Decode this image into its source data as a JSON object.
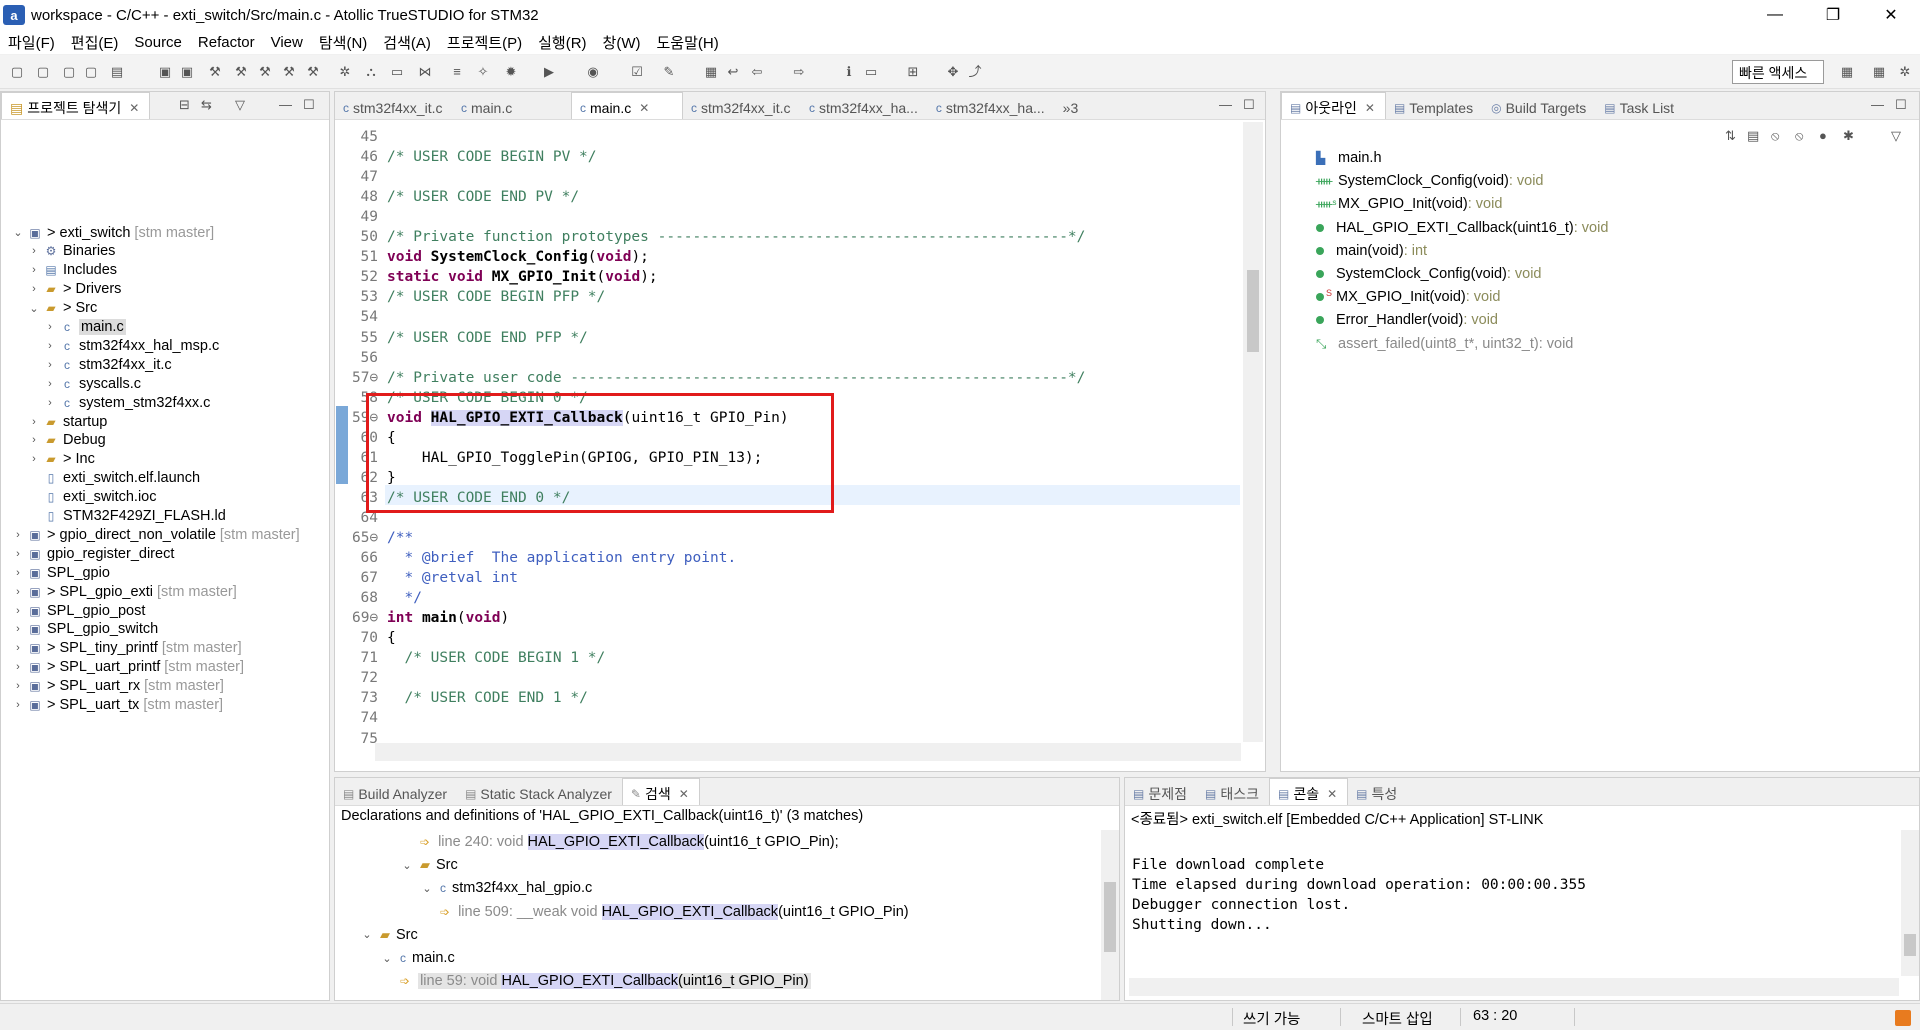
{
  "window": {
    "title": "workspace - C/C++ - exti_switch/Src/main.c - Atollic TrueSTUDIO for STM32",
    "app_icon": "a",
    "minimize": "—",
    "maximize": "❐",
    "close": "✕"
  },
  "menu": [
    "파일(F)",
    "편집(E)",
    "Source",
    "Refactor",
    "View",
    "탐색(N)",
    "검색(A)",
    "프로젝트(P)",
    "실행(R)",
    "창(W)",
    "도움말(H)"
  ],
  "toolbar": {
    "quick_access": "빠른 액세스"
  },
  "explorer": {
    "tab_label": "프로젝트 탐색기",
    "items": [
      {
        "indent": 0,
        "twisty": "⌄",
        "icon": "proj",
        "prefix": "> ",
        "label": "exti_switch",
        "git": "[stm master]"
      },
      {
        "indent": 1,
        "twisty": "›",
        "icon": "bin",
        "prefix": "",
        "label": "Binaries",
        "git": ""
      },
      {
        "indent": 1,
        "twisty": "›",
        "icon": "inc",
        "prefix": "",
        "label": "Includes",
        "git": ""
      },
      {
        "indent": 1,
        "twisty": "›",
        "icon": "folder-src",
        "prefix": "> ",
        "label": "Drivers",
        "git": ""
      },
      {
        "indent": 1,
        "twisty": "⌄",
        "icon": "folder-src",
        "prefix": "> ",
        "label": "Src",
        "git": ""
      },
      {
        "indent": 2,
        "twisty": "›",
        "icon": "cfile",
        "prefix": "",
        "label": "main.c",
        "git": ""
      },
      {
        "indent": 2,
        "twisty": "›",
        "icon": "cfile",
        "prefix": "",
        "label": "stm32f4xx_hal_msp.c",
        "git": ""
      },
      {
        "indent": 2,
        "twisty": "›",
        "icon": "cfile",
        "prefix": "",
        "label": "stm32f4xx_it.c",
        "git": ""
      },
      {
        "indent": 2,
        "twisty": "›",
        "icon": "cfile",
        "prefix": "",
        "label": "syscalls.c",
        "git": ""
      },
      {
        "indent": 2,
        "twisty": "›",
        "icon": "cfile",
        "prefix": "",
        "label": "system_stm32f4xx.c",
        "git": ""
      },
      {
        "indent": 1,
        "twisty": "›",
        "icon": "folder-src",
        "prefix": "",
        "label": "startup",
        "git": ""
      },
      {
        "indent": 1,
        "twisty": "›",
        "icon": "folder",
        "prefix": "",
        "label": "Debug",
        "git": ""
      },
      {
        "indent": 1,
        "twisty": "›",
        "icon": "folder-src",
        "prefix": "> ",
        "label": "Inc",
        "git": ""
      },
      {
        "indent": 1,
        "twisty": "",
        "icon": "file",
        "prefix": "",
        "label": "exti_switch.elf.launch",
        "git": ""
      },
      {
        "indent": 1,
        "twisty": "",
        "icon": "file",
        "prefix": "",
        "label": "exti_switch.ioc",
        "git": ""
      },
      {
        "indent": 1,
        "twisty": "",
        "icon": "file",
        "prefix": "",
        "label": "STM32F429ZI_FLASH.ld",
        "git": ""
      },
      {
        "indent": 0,
        "twisty": "›",
        "icon": "proj",
        "prefix": "> ",
        "label": "gpio_direct_non_volatile",
        "git": "[stm master]"
      },
      {
        "indent": 0,
        "twisty": "›",
        "icon": "proj",
        "prefix": "",
        "label": "gpio_register_direct",
        "git": ""
      },
      {
        "indent": 0,
        "twisty": "›",
        "icon": "proj",
        "prefix": "",
        "label": "SPL_gpio",
        "git": ""
      },
      {
        "indent": 0,
        "twisty": "›",
        "icon": "proj",
        "prefix": "> ",
        "label": "SPL_gpio_exti",
        "git": "[stm master]"
      },
      {
        "indent": 0,
        "twisty": "›",
        "icon": "proj",
        "prefix": "",
        "label": "SPL_gpio_post",
        "git": ""
      },
      {
        "indent": 0,
        "twisty": "›",
        "icon": "proj",
        "prefix": "",
        "label": "SPL_gpio_switch",
        "git": ""
      },
      {
        "indent": 0,
        "twisty": "›",
        "icon": "proj",
        "prefix": "> ",
        "label": "SPL_tiny_printf",
        "git": "[stm master]"
      },
      {
        "indent": 0,
        "twisty": "›",
        "icon": "proj",
        "prefix": "> ",
        "label": "SPL_uart_printf",
        "git": "[stm master]"
      },
      {
        "indent": 0,
        "twisty": "›",
        "icon": "proj",
        "prefix": "> ",
        "label": "SPL_uart_rx",
        "git": "[stm master]"
      },
      {
        "indent": 0,
        "twisty": "›",
        "icon": "proj",
        "prefix": "> ",
        "label": "SPL_uart_tx",
        "git": "[stm master]"
      }
    ]
  },
  "editor": {
    "tabs": [
      "stm32f4xx_it.c",
      "main.c",
      "main.c",
      "stm32f4xx_it.c",
      "stm32f4xx_ha...",
      "stm32f4xx_ha..."
    ],
    "overflow": "»3",
    "active_tab": 2,
    "lines": [
      {
        "n": "45",
        "html": ""
      },
      {
        "n": "46",
        "html": "<span class='cmt'>/* USER CODE BEGIN PV */</span>"
      },
      {
        "n": "47",
        "html": ""
      },
      {
        "n": "48",
        "html": "<span class='cmt'>/* USER CODE END PV */</span>"
      },
      {
        "n": "49",
        "html": ""
      },
      {
        "n": "50",
        "html": "<span class='cmt'>/* Private function prototypes -----------------------------------------------*/</span>"
      },
      {
        "n": "51",
        "html": "<span class='kw'>void</span> <span class='fnb'>SystemClock_Config</span>(<span class='kw'>void</span>);"
      },
      {
        "n": "52",
        "html": "<span class='kw'>static void</span> <span class='fnb'>MX_GPIO_Init</span>(<span class='kw'>void</span>);"
      },
      {
        "n": "53",
        "html": "<span class='cmt'>/* USER CODE BEGIN PFP */</span>"
      },
      {
        "n": "54",
        "html": ""
      },
      {
        "n": "55",
        "html": "<span class='cmt'>/* USER CODE END PFP */</span>"
      },
      {
        "n": "56",
        "html": ""
      },
      {
        "n": "57⊖",
        "html": "<span class='cmt'>/* Private user code ---------------------------------------------------------*/</span>"
      },
      {
        "n": "58",
        "html": "<span class='cmt'>/* USER CODE BEGIN 0 */</span>"
      },
      {
        "n": "59⊖",
        "html": "<span class='kw'>void</span> <span class='fnb hl'>HAL_GPIO_EXTI_Callback</span>(uint16_t GPIO_Pin)"
      },
      {
        "n": "60",
        "html": "{"
      },
      {
        "n": "61",
        "html": "    HAL_GPIO_TogglePin(GPIOG, GPIO_PIN_13);"
      },
      {
        "n": "62",
        "html": "}"
      },
      {
        "n": "63",
        "html": "<span class='cmt'>/* USER CODE END 0 */</span>"
      },
      {
        "n": "64",
        "html": ""
      },
      {
        "n": "65⊖",
        "html": "<span class='doc'>/**</span>"
      },
      {
        "n": "66",
        "html": "<span class='doc'>  * @brief  The application entry point.</span>"
      },
      {
        "n": "67",
        "html": "<span class='doc'>  * @retval int</span>"
      },
      {
        "n": "68",
        "html": "<span class='doc'>  */</span>"
      },
      {
        "n": "69⊖",
        "html": "<span class='kw'>int</span> <span class='fnb'>main</span>(<span class='kw'>void</span>)"
      },
      {
        "n": "70",
        "html": "{"
      },
      {
        "n": "71",
        "html": "  <span class='cmt'>/* USER CODE BEGIN 1 */</span>"
      },
      {
        "n": "72",
        "html": ""
      },
      {
        "n": "73",
        "html": "  <span class='cmt'>/* USER CODE END 1 */</span>"
      },
      {
        "n": "74",
        "html": ""
      },
      {
        "n": "75",
        "html": ""
      }
    ]
  },
  "outline": {
    "tabs": [
      "아웃라인",
      "Templates",
      "Build Targets",
      "Task List"
    ],
    "items": [
      {
        "icon": "header",
        "name": "main.h",
        "type": ""
      },
      {
        "icon": "decl",
        "name": "SystemClock_Config(void)",
        "type": " : void"
      },
      {
        "icon": "decl-static",
        "name": "MX_GPIO_Init(void)",
        "type": " : void"
      },
      {
        "icon": "func",
        "name": "HAL_GPIO_EXTI_Callback(uint16_t)",
        "type": " : void"
      },
      {
        "icon": "func",
        "name": "main(void)",
        "type": " : int"
      },
      {
        "icon": "func",
        "name": "SystemClock_Config(void)",
        "type": " : void"
      },
      {
        "icon": "func-static",
        "name": "MX_GPIO_Init(void)",
        "type": " : void"
      },
      {
        "icon": "func",
        "name": "Error_Handler(void)",
        "type": " : void"
      },
      {
        "icon": "inactive",
        "name": "assert_failed(uint8_t*, uint32_t)",
        "type": " : void"
      }
    ]
  },
  "search": {
    "tabs": [
      "Build Analyzer",
      "Static Stack Analyzer",
      "검색"
    ],
    "summary": "Declarations and definitions of 'HAL_GPIO_EXTI_Callback(uint16_t)' (3 matches)",
    "results": [
      {
        "indent": 3,
        "twisty": "",
        "icon": "match",
        "pre": "line 240:  void ",
        "match": "HAL_GPIO_EXTI_Callback",
        "post": "(uint16_t GPIO_Pin);"
      },
      {
        "indent": 2,
        "twisty": "⌄",
        "icon": "folder",
        "pre": "",
        "match": "",
        "post": "Src"
      },
      {
        "indent": 3,
        "twisty": "⌄",
        "icon": "cfile",
        "pre": "",
        "match": "",
        "post": "stm32f4xx_hal_gpio.c"
      },
      {
        "indent": 4,
        "twisty": "",
        "icon": "match",
        "pre": "line 509:  __weak void ",
        "match": "HAL_GPIO_EXTI_Callback",
        "post": "(uint16_t GPIO_Pin)"
      },
      {
        "indent": 0,
        "twisty": "⌄",
        "icon": "folder",
        "pre": "",
        "match": "",
        "post": "Src"
      },
      {
        "indent": 1,
        "twisty": "⌄",
        "icon": "cfile",
        "pre": "",
        "match": "",
        "post": "main.c"
      },
      {
        "indent": 2,
        "twisty": "",
        "icon": "match",
        "pre": "line 59:  void ",
        "match": "HAL_GPIO_EXTI_Callback",
        "post": "(uint16_t GPIO_Pin)"
      }
    ]
  },
  "console": {
    "tabs": [
      "문제점",
      "태스크",
      "콘솔",
      "특성"
    ],
    "header": "<종료됨> exti_switch.elf [Embedded C/C++ Application] ST-LINK",
    "lines": [
      "File download complete",
      "Time elapsed during download operation: 00:00:00.355",
      "Debugger connection lost.",
      "Shutting down..."
    ]
  },
  "status": {
    "writable": "쓰기 가능",
    "insert_mode": "스마트 삽입",
    "position": "63 : 20"
  }
}
